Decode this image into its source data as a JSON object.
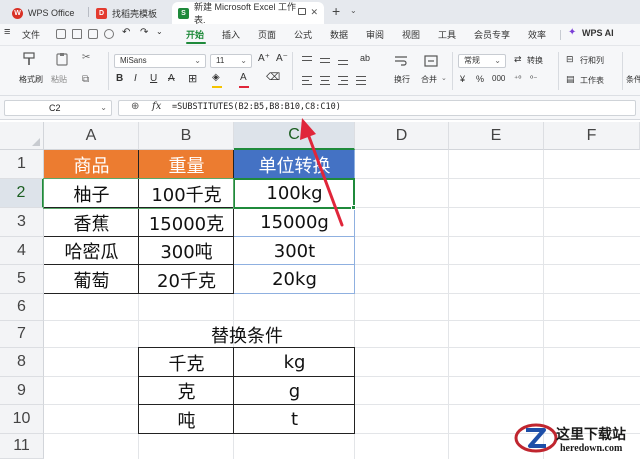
{
  "tabs": [
    {
      "label": "WPS Office",
      "icon": "wps-logo-icon",
      "color": "#d93025"
    },
    {
      "label": "找稻壳模板",
      "icon": "docer-icon",
      "color": "#e33b2f"
    },
    {
      "label": "新建 Microsoft Excel 工作表.",
      "icon": "spreadsheet-icon",
      "color": "#1f8a3b",
      "badge": "S",
      "active": true
    }
  ],
  "menu": {
    "file": "文件",
    "items": [
      "开始",
      "插入",
      "页面",
      "公式",
      "数据",
      "审阅",
      "视图",
      "工具",
      "会员专享",
      "效率"
    ],
    "active": "开始",
    "wps_ai": "WPS AI"
  },
  "ribbon": {
    "format_painter": "格式刷",
    "paste": "粘贴",
    "font_name": "MiSans",
    "font_size": "11",
    "wrap": "换行",
    "merge": "合并",
    "number_format": "常规",
    "convert": "转换",
    "rows_cols": "行和列",
    "worksheet": "工作表",
    "conditional": "条件"
  },
  "formula_bar": {
    "cell_ref": "C2",
    "fx": "fx",
    "formula": "=SUBSTITUTES(B2:B5,B8:B10,C8:C10)"
  },
  "columns": [
    "A",
    "B",
    "C",
    "D",
    "E",
    "F"
  ],
  "rows": [
    "1",
    "2",
    "3",
    "4",
    "5",
    "6",
    "7",
    "8",
    "9",
    "10",
    "11"
  ],
  "table1": {
    "headers": [
      "商品",
      "重量",
      "单位转换"
    ],
    "rows": [
      [
        "柚子",
        "100千克",
        "100kg"
      ],
      [
        "香蕉",
        "15000克",
        "15000g"
      ],
      [
        "哈密瓜",
        "300吨",
        "300t"
      ],
      [
        "葡萄",
        "20千克",
        "20kg"
      ]
    ]
  },
  "table2": {
    "title": "替换条件",
    "rows": [
      [
        "千克",
        "kg"
      ],
      [
        "克",
        "g"
      ],
      [
        "吨",
        "t"
      ]
    ]
  },
  "watermark": {
    "name": "这里下载站",
    "url": "heredown.com"
  },
  "colors": {
    "accent": "#1f8a3b",
    "header_orange": "#ec7c30",
    "header_blue": "#4472c4",
    "annotation_arrow": "#e0263a"
  }
}
